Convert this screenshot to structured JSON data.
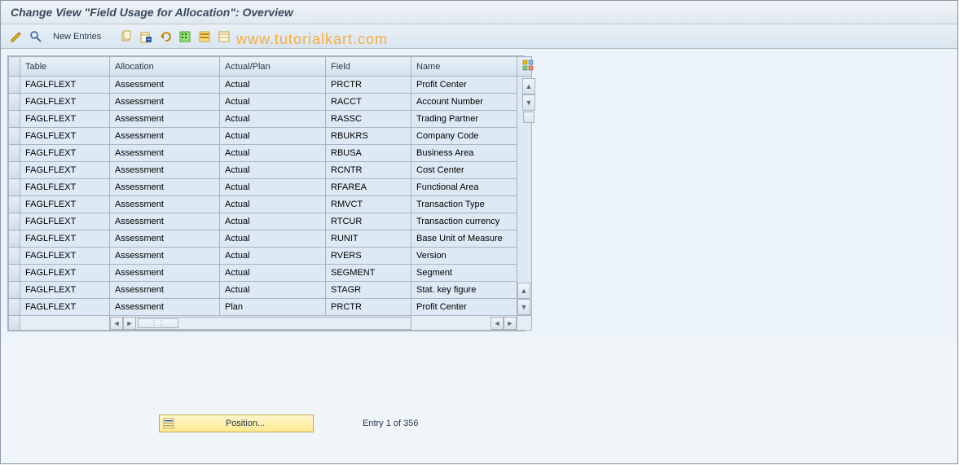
{
  "header": {
    "title": "Change View \"Field Usage for Allocation\": Overview"
  },
  "toolbar": {
    "new_entries": "New Entries"
  },
  "watermark": "www.tutorialkart.com",
  "table": {
    "columns": [
      "Table",
      "Allocation",
      "Actual/Plan",
      "Field",
      "Name"
    ],
    "rows": [
      {
        "table": "FAGLFLEXT",
        "alloc": "Assessment",
        "ap": "Actual",
        "field": "PRCTR",
        "name": "Profit Center"
      },
      {
        "table": "FAGLFLEXT",
        "alloc": "Assessment",
        "ap": "Actual",
        "field": "RACCT",
        "name": "Account Number"
      },
      {
        "table": "FAGLFLEXT",
        "alloc": "Assessment",
        "ap": "Actual",
        "field": "RASSC",
        "name": "Trading Partner"
      },
      {
        "table": "FAGLFLEXT",
        "alloc": "Assessment",
        "ap": "Actual",
        "field": "RBUKRS",
        "name": "Company Code"
      },
      {
        "table": "FAGLFLEXT",
        "alloc": "Assessment",
        "ap": "Actual",
        "field": "RBUSA",
        "name": "Business Area"
      },
      {
        "table": "FAGLFLEXT",
        "alloc": "Assessment",
        "ap": "Actual",
        "field": "RCNTR",
        "name": "Cost Center"
      },
      {
        "table": "FAGLFLEXT",
        "alloc": "Assessment",
        "ap": "Actual",
        "field": "RFAREA",
        "name": "Functional Area"
      },
      {
        "table": "FAGLFLEXT",
        "alloc": "Assessment",
        "ap": "Actual",
        "field": "RMVCT",
        "name": "Transaction Type"
      },
      {
        "table": "FAGLFLEXT",
        "alloc": "Assessment",
        "ap": "Actual",
        "field": "RTCUR",
        "name": "Transaction currency"
      },
      {
        "table": "FAGLFLEXT",
        "alloc": "Assessment",
        "ap": "Actual",
        "field": "RUNIT",
        "name": "Base Unit of Measure"
      },
      {
        "table": "FAGLFLEXT",
        "alloc": "Assessment",
        "ap": "Actual",
        "field": "RVERS",
        "name": "Version"
      },
      {
        "table": "FAGLFLEXT",
        "alloc": "Assessment",
        "ap": "Actual",
        "field": "SEGMENT",
        "name": "Segment"
      },
      {
        "table": "FAGLFLEXT",
        "alloc": "Assessment",
        "ap": "Actual",
        "field": "STAGR",
        "name": "Stat. key figure"
      },
      {
        "table": "FAGLFLEXT",
        "alloc": "Assessment",
        "ap": "Plan",
        "field": "PRCTR",
        "name": "Profit Center"
      }
    ]
  },
  "footer": {
    "position_label": "Position...",
    "entry_text": "Entry 1 of 356"
  }
}
